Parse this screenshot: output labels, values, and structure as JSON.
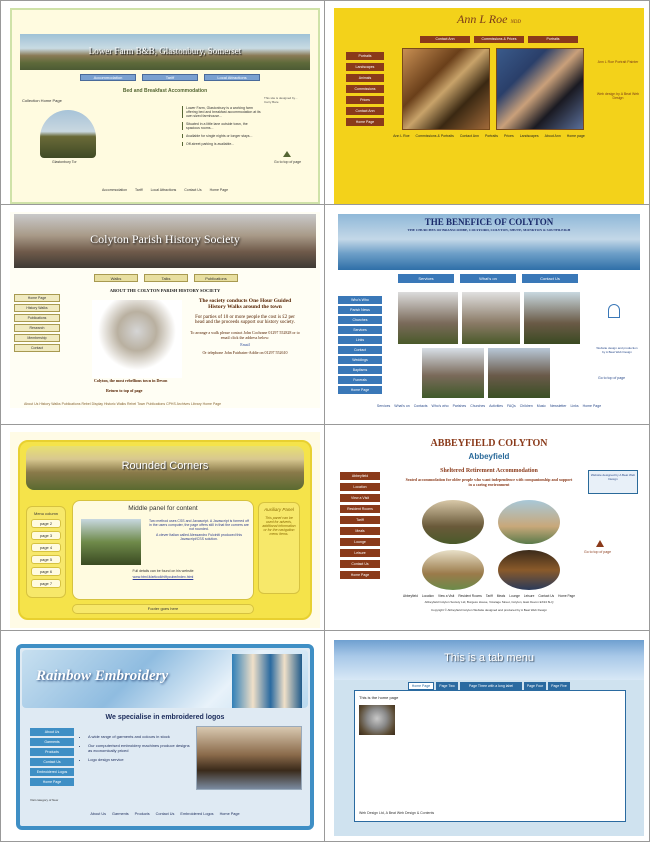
{
  "panels": {
    "farm": {
      "title": "Lower Farm B&B, Glastonbury, Somerset",
      "nav": [
        "Accommodation",
        "Tariff",
        "Local Attractions"
      ],
      "heading": "Bed and Breakfast Accommodation",
      "side_note": "Collection Home Page",
      "side_note2": "This site is designed by... Carry Bare",
      "caption": "Glastonbury Tor",
      "top_label": "Go to top of page",
      "bullets": [
        "Lower Farm, Glastonbury is a working farm offering bed and breakfast accommodation at its own sized farmhouse...",
        "Situated in a little lane outside town, the spacious rooms...",
        "Available for single nights or longer stays...",
        "Off-street parking is available..."
      ],
      "footer": [
        "Accommodation",
        "Tariff",
        "Local Attractions",
        "Contact Us",
        "Home Page"
      ]
    },
    "annroe": {
      "title": "Ann L Roe",
      "title_suffix": "NDD",
      "top_tabs": [
        "Contact Ann",
        "Commissions & Prices",
        "Portraits"
      ],
      "side_menu": [
        "Portraits",
        "Landscapes",
        "Animals",
        "Commissions",
        "Prices",
        "Contact Ann",
        "Home Page"
      ],
      "right_note": "Ann L Roe Portrait Painter",
      "right_note2": "Web design by A Beat Web Design",
      "footer": [
        "Ann L Roe",
        "Commissions & Portraits",
        "Contact Ann",
        "Portraits",
        "Prices",
        "Landscapes",
        "About Ann",
        "Home page"
      ]
    },
    "colyton": {
      "title": "Colyton Parish History Society",
      "tabs": [
        "Walks",
        "Talks",
        "Publications"
      ],
      "heading": "ABOUT THE COLYTON PARISH HISTORY SOCIETY",
      "side_menu": [
        "Home Page",
        "History Walks",
        "Publications",
        "Research",
        "Membership",
        "Contact"
      ],
      "para1": "The society conducts One Hour Guided History Walks around the town",
      "para2": "For parties of 10 or more people the cost is £2 per head and the proceeds support our history society.",
      "para3": "To arrange a walk please contact John Cochrane 01297 552828 or to email click the address below:",
      "email_label": "Email",
      "para4": "Or telephone John Fairbairn-Addie on 01297 552610",
      "caption": "Colyton, the most rebellious town in Devon",
      "top_link": "Return to top of page",
      "footer": "About Us  History Walks  Publications  Rebel Display  Historic Walks  Rebel Town  Publications  CPHS Archives  Library  Home Page"
    },
    "benefice": {
      "title": "THE BENEFICE OF COLYTON",
      "subtitle": "THE CHURCHES OF BRANSCOMBE, COLYFORD, COLYTON, SHUTE, MONKTON & SOUTHLEIGH",
      "tabs": [
        "Services",
        "What's on",
        "Contact Us"
      ],
      "side_menu": [
        "Who's Who",
        "Parish News",
        "Churches",
        "Services",
        "Links",
        "Contact",
        "Weddings",
        "Baptisms",
        "Funerals",
        "Home Page"
      ],
      "right_note": "Website design and production by A Beat Web Design",
      "top_link": "Go to top of page",
      "footer": [
        "Services",
        "What's on",
        "Contacts",
        "Who's who",
        "Parishes",
        "Churches",
        "Activities",
        "FAQs",
        "Children",
        "Music",
        "Newsletter",
        "Links",
        "Home Page"
      ]
    },
    "rounded": {
      "title": "Rounded Corners",
      "menu_title": "Menu column",
      "menu": [
        "page 2",
        "page 3",
        "page 4",
        "page 5",
        "page 6",
        "page 7"
      ],
      "middle_title": "Middle panel for content",
      "middle_text": "Two method uses CSS and Javascript. A Javascript is formed off in the users computer, the page offers still in that the corners are not rounded.",
      "middle_text2": "A clever Italian called Alessandro Fulciniti produced this Javascript/CSS solution.",
      "full_details": "Full details can be found on his website",
      "full_link": "www.html.it/articoli/niftycube/index.html",
      "aux_title": "Auxiliary Panel",
      "aux_text": "This panel can be used for adverts, additional information or for the navigation menu items.",
      "footer": "Footer goes here"
    },
    "abbeyfield": {
      "title": "ABBEYFIELD COLYTON",
      "logo": "Abbeyfield",
      "subtitle": "Sheltered Retirement Accommodation",
      "subtitle2": "Seated accommodation for older people who want independence with companionship and support in a caring environment",
      "side_menu": [
        "Abbeyfield",
        "Location",
        "View a Visit",
        "Resident Rooms",
        "Tariff",
        "Meals",
        "Lounge",
        "Leisure",
        "Contact Us",
        "Home Page"
      ],
      "right_note": "Website designed by A Beat Web Design",
      "top_link": "Go to top of page",
      "footer": [
        "Abbeyfield",
        "Location",
        "View a Visit",
        "Resident Rooms",
        "Tariff",
        "Meals",
        "Lounge",
        "Leisure",
        "Contact Us",
        "Home Page"
      ],
      "address": "Abbeyfield Colyton Society Ltd, Burgess House, Vicarage Street, Colyton, East Devon EX24 6LQ",
      "copyright": "Copyright © Abbeyfield Colyton   Website designed and produced by A Beat Web Design"
    },
    "rainbow": {
      "title": "Rainbow Embroidery",
      "heading": "We specialise in embroidered logos",
      "side_menu": [
        "About Us",
        "Garments",
        "Products",
        "Contact Us",
        "Embroidered Logos",
        "Home Page"
      ],
      "bullets": [
        "A wide range of garments and colours in stock",
        "Our computerised embroidery machines produce designs as economically priced",
        "Logo design service"
      ],
      "note": "Visit category of New",
      "footer": [
        "About Us",
        "Garments",
        "Products",
        "Contact Us",
        "Embroidered Logos",
        "Home Page"
      ]
    },
    "tabmenu": {
      "title": "This is a tab menu",
      "tabs": [
        "Home Page",
        "Page Two",
        "Page Three with a long label",
        "Page Four",
        "Page Five"
      ],
      "body_text": "This is the home page",
      "footer": "Web Design Ltd, A Beat Web Design & Contents"
    }
  },
  "colors": {
    "farm_accent": "#7aa0d0",
    "annroe_bg": "#f3d21a",
    "annroe_button": "#8a3a1a",
    "colyton_accent": "#e8dfa0",
    "benefice_blue": "#3a78b8",
    "rounded_yellow": "#f5e34a",
    "abbeyfield_brown": "#8a3a1a",
    "rainbow_blue": "#3f8fc5",
    "tab_blue": "#2a6aa0"
  }
}
